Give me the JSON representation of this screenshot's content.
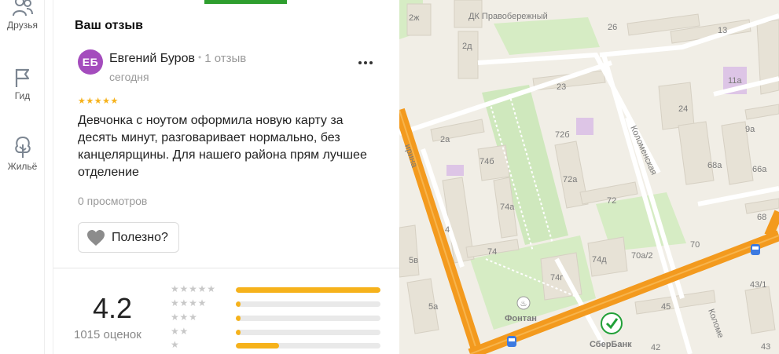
{
  "nav": {
    "friends_label": "Друзья",
    "guide_label": "Гид",
    "housing_label": "Жильё"
  },
  "review": {
    "heading": "Ваш отзыв",
    "avatar_initials": "ЕБ",
    "author_name": "Евгений Буров",
    "author_reviews_count": "1 отзыв",
    "date": "сегодня",
    "rating_stars": "★★★★★",
    "text": "Девчонка с ноутом оформила новую карту за десять минут, разговаривает нормально, без канцелярщины. Для нашего района прям лучшее отделение",
    "views": "0 просмотров",
    "useful_label": "Полезно?"
  },
  "rating": {
    "score": "4.2",
    "reviews_count": "1015 оценок",
    "distribution": [
      {
        "stars": "★★★★★",
        "fraction": 1.0
      },
      {
        "stars": "★★★★",
        "fraction": 0.03
      },
      {
        "stars": "★★★",
        "fraction": 0.03
      },
      {
        "stars": "★★",
        "fraction": 0.03
      },
      {
        "stars": "★",
        "fraction": 0.3
      }
    ]
  },
  "map": {
    "labels": {
      "dk": "ДК Правобережный",
      "street_kolomenskaya": "Коломенская",
      "street_kolomenskaya_2": "Коломе",
      "street_lenina_partial": "ирина",
      "poi_fontan": "Фонтан",
      "poi_sberbank": "СберБанк",
      "b_2zh": "2ж",
      "b_2d": "2д",
      "b_26": "26",
      "b_13": "13",
      "b_11a": "11а",
      "b_23": "23",
      "b_24": "24",
      "b_9a": "9а",
      "b_72b": "72б",
      "b_2a": "2а",
      "b_74b": "74б",
      "b_72a": "72а",
      "b_68a": "68а",
      "b_66a": "66а",
      "b_74a": "74а",
      "b_72": "72",
      "b_68": "68",
      "b_4": "4",
      "b_74": "74",
      "b_74d": "74д",
      "b_70a2": "70а/2",
      "b_70": "70",
      "b_5v": "5в",
      "b_74g": "74г",
      "b_43_1": "43/1",
      "b_5a": "5а",
      "b_45": "45",
      "b_42": "42",
      "b_43": "43"
    }
  },
  "colors": {
    "accent_green": "#2e9e2e",
    "avatar_purple": "#a44cbd",
    "star_yellow": "#f6b21b",
    "road_orange": "#f39a1e",
    "sber_green": "#21a038"
  }
}
